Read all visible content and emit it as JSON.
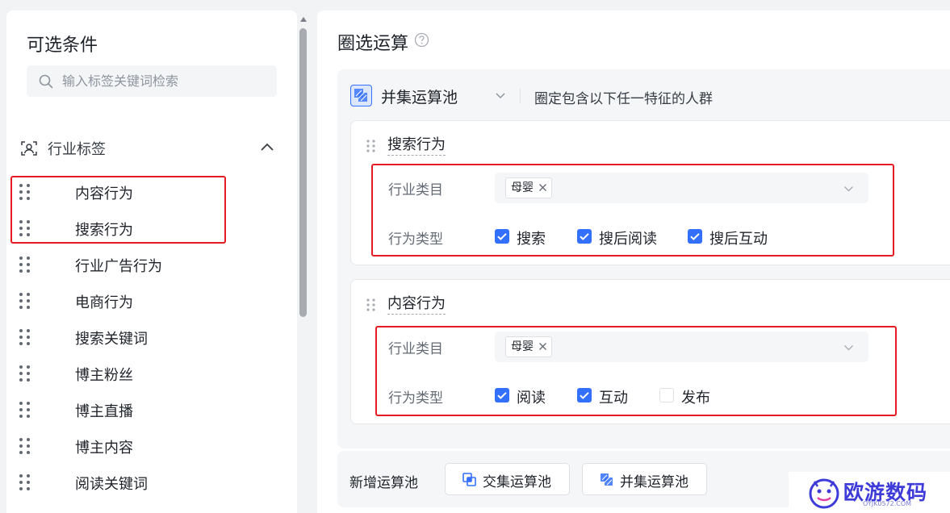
{
  "left": {
    "title": "可选条件",
    "search": {
      "placeholder": "输入标签关键词检索",
      "value": ""
    },
    "group": {
      "label": "行业标签",
      "expanded": true
    },
    "items": [
      {
        "label": "内容行为"
      },
      {
        "label": "搜索行为"
      },
      {
        "label": "行业广告行为"
      },
      {
        "label": "电商行为"
      },
      {
        "label": "搜索关键词"
      },
      {
        "label": "博主粉丝"
      },
      {
        "label": "博主直播"
      },
      {
        "label": "博主内容"
      },
      {
        "label": "阅读关键词"
      }
    ]
  },
  "right": {
    "title": "圈选运算",
    "pool": {
      "name": "并集运算池",
      "description": "圈定包含以下任一特征的人群"
    },
    "cards": [
      {
        "title": "搜索行为",
        "category_label": "行业类目",
        "category_chip": "母婴",
        "type_label": "行为类型",
        "options": [
          {
            "label": "搜索",
            "checked": true
          },
          {
            "label": "搜后阅读",
            "checked": true
          },
          {
            "label": "搜后互动",
            "checked": true
          }
        ]
      },
      {
        "title": "内容行为",
        "category_label": "行业类目",
        "category_chip": "母婴",
        "type_label": "行为类型",
        "options": [
          {
            "label": "阅读",
            "checked": true
          },
          {
            "label": "互动",
            "checked": true
          },
          {
            "label": "发布",
            "checked": false
          }
        ]
      }
    ],
    "add": {
      "label": "新增运算池",
      "intersect_button": "交集运算池",
      "union_button": "并集运算池"
    }
  },
  "watermark": {
    "text": "欧游数码",
    "sub": "OYJK0572.COM"
  },
  "colors": {
    "accent": "#3370ff",
    "highlight": "#e51c23",
    "watermark": "#3f3bd9"
  }
}
